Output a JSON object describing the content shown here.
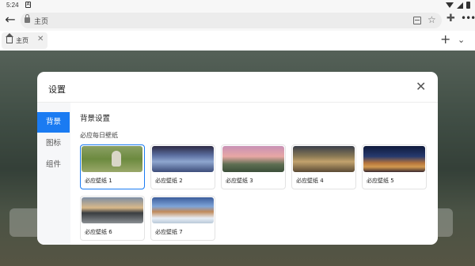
{
  "status_bar": {
    "time": "5:24",
    "notification_icon": "notification-a-icon"
  },
  "address_bar": {
    "url": "主页"
  },
  "tab": {
    "label": "主页"
  },
  "modal": {
    "title": "设置",
    "sidebar": [
      {
        "label": "背景",
        "active": true
      },
      {
        "label": "图标",
        "active": false
      },
      {
        "label": "组件",
        "active": false
      }
    ],
    "section_title": "背景设置",
    "subtitle": "必应每日壁纸",
    "wallpapers": [
      {
        "label": "必应壁纸 1",
        "selected": true
      },
      {
        "label": "必应壁纸 2",
        "selected": false
      },
      {
        "label": "必应壁纸 3",
        "selected": false
      },
      {
        "label": "必应壁纸 4",
        "selected": false
      },
      {
        "label": "必应壁纸 5",
        "selected": false
      },
      {
        "label": "必应壁纸 6",
        "selected": false
      },
      {
        "label": "必应壁纸 7",
        "selected": false
      }
    ]
  },
  "colors": {
    "accent": "#1a7bf2"
  }
}
